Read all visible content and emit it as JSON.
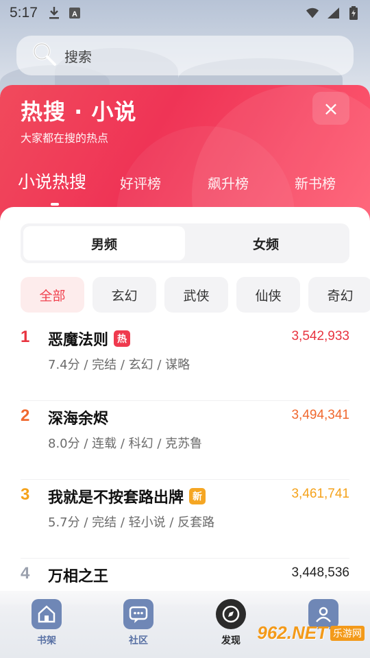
{
  "status_bar": {
    "time": "5:17"
  },
  "search": {
    "placeholder": "搜索"
  },
  "hot": {
    "title": "热搜 · 小说",
    "subtitle": "大家都在搜的热点",
    "close_symbol": "×",
    "tabs": [
      {
        "label": "小说热搜",
        "active": true
      },
      {
        "label": "好评榜",
        "active": false
      },
      {
        "label": "飙升榜",
        "active": false
      },
      {
        "label": "新书榜",
        "active": false
      }
    ]
  },
  "gender": {
    "male": "男频",
    "female": "女频",
    "selected": "男频"
  },
  "categories": [
    "全部",
    "玄幻",
    "武侠",
    "仙侠",
    "奇幻"
  ],
  "selected_category": "全部",
  "rankings": [
    {
      "rank": "1",
      "title": "恶魔法则",
      "badge": "热",
      "badge_color": "#ef3a4e",
      "meta": "7.4分 / 完结 / 玄幻 / 谋略",
      "count": "3,542,933",
      "color": "#e8333f"
    },
    {
      "rank": "2",
      "title": "深海余烬",
      "badge": "",
      "badge_color": "",
      "meta": "8.0分 / 连载 / 科幻 / 克苏鲁",
      "count": "3,494,341",
      "color": "#f0682e"
    },
    {
      "rank": "3",
      "title": "我就是不按套路出牌",
      "badge": "新",
      "badge_color": "#f5a623",
      "meta": "5.7分 / 完结 / 轻小说 / 反套路",
      "count": "3,461,741",
      "color": "#f5a21a"
    },
    {
      "rank": "4",
      "title": "万相之王",
      "badge": "",
      "badge_color": "",
      "meta": "",
      "count": "3,448,536",
      "color": "#9aa0ad"
    }
  ],
  "bottom_nav": [
    {
      "label": "书架",
      "icon": "house-icon"
    },
    {
      "label": "社区",
      "icon": "chat-icon"
    },
    {
      "label": "发现",
      "icon": "compass-icon"
    },
    {
      "label": "我的",
      "icon": "user-icon"
    }
  ],
  "watermark": {
    "logo": "962.NET",
    "text": "乐游网"
  }
}
